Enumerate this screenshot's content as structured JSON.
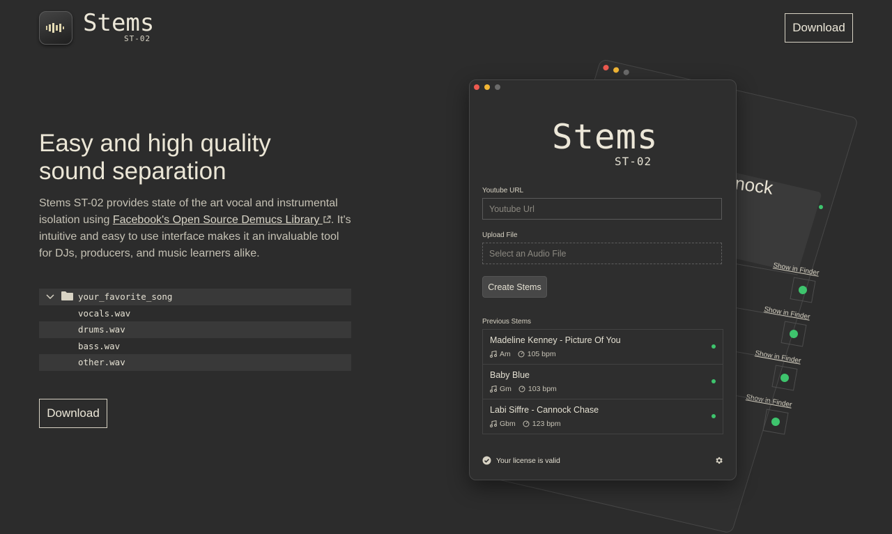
{
  "header": {
    "brand": "Stems",
    "brand_sub": "ST-02",
    "download_label": "Download"
  },
  "hero": {
    "headline_line1": "Easy and high quality",
    "headline_line2": "sound separation",
    "desc_part1": "Stems ST-02 provides state of the art vocal and instrumental isolation using ",
    "desc_link": "Facebook's Open Source Demucs Library",
    "desc_part2": ". It's intuitive and easy to use interface makes it an invaluable tool for DJs, producers, and music learners alike.",
    "download_label": "Download"
  },
  "file_tree": {
    "folder": "your_favorite_song",
    "files": [
      "vocals.wav",
      "drums.wav",
      "bass.wav",
      "other.wav"
    ]
  },
  "app_window": {
    "logo": "Stems",
    "logo_sub": "ST-02",
    "youtube_label": "Youtube URL",
    "youtube_placeholder": "Youtube Url",
    "upload_label": "Upload File",
    "upload_placeholder": "Select an Audio File",
    "create_label": "Create Stems",
    "previous_label": "Previous Stems",
    "stems": [
      {
        "title": "Madeline Kenney - Picture Of You",
        "key": "Am",
        "bpm": "105 bpm"
      },
      {
        "title": "Baby Blue",
        "key": "Gm",
        "bpm": "103 bpm"
      },
      {
        "title": "Labi Siffre - Cannock Chase",
        "key": "Gbm",
        "bpm": "123 bpm"
      }
    ],
    "license": "Your license is valid"
  },
  "back_window": {
    "title_fragment": "nnock",
    "show_in_finder": "Show in Finder"
  },
  "colors": {
    "background": "#2c2c2c",
    "text": "#e4e0d2",
    "status_green": "#3ec46d",
    "traffic_red": "#ee5a50",
    "traffic_yellow": "#f2b635",
    "traffic_gray": "#6b6b6b"
  }
}
